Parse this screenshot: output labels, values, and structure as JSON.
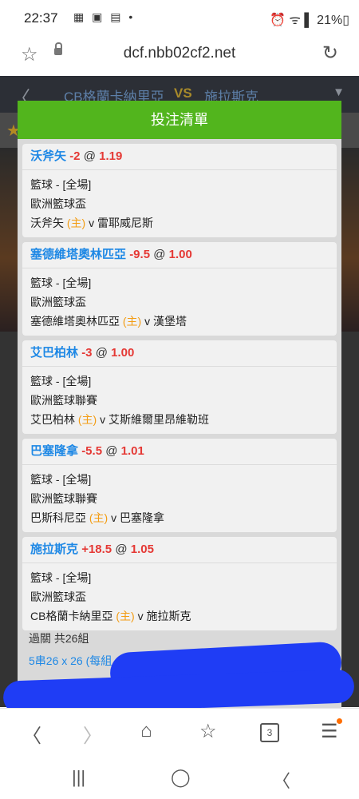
{
  "status_bar": {
    "time": "22:37",
    "icons": "▦ ▣ ▤ •",
    "right": "⏰ ᯤ ▌ 21%▯"
  },
  "browser": {
    "url": "dcf.nbb02cf2.net"
  },
  "page": {
    "team1": "CB格蘭卡納里亞",
    "vs": "VS",
    "team2": "施拉斯克"
  },
  "modal": {
    "title": "投注清單",
    "bets": [
      {
        "team": "沃斧矢",
        "line": "-2",
        "at": "@",
        "odds": "1.19",
        "sport": "籃球 - [全場]",
        "league": "歐洲籃球盃",
        "home_team": "沃斧矢",
        "home_tag": "(主)",
        "versus": "v 雷耶威尼斯"
      },
      {
        "team": "塞德維塔奧林匹亞",
        "line": "-9.5",
        "at": "@",
        "odds": "1.00",
        "sport": "籃球 - [全場]",
        "league": "歐洲籃球盃",
        "home_team": "塞德維塔奧林匹亞",
        "home_tag": "(主)",
        "versus": "v 漢堡塔"
      },
      {
        "team": "艾巴柏林",
        "line": "-3",
        "at": "@",
        "odds": "1.00",
        "sport": "籃球 - [全場]",
        "league": "歐洲籃球聯賽",
        "home_team": "艾巴柏林",
        "home_tag": "(主)",
        "versus": "v 艾斯維爾里昂維勒班"
      },
      {
        "team": "巴塞隆拿",
        "line": "-5.5",
        "at": "@",
        "odds": "1.01",
        "sport": "籃球 - [全場]",
        "league": "歐洲籃球聯賽",
        "home_team": "巴斯科尼亞",
        "home_tag": "(主)",
        "versus": "v 巴塞隆拿"
      },
      {
        "team": "施拉斯克",
        "line": "+18.5",
        "at": "@",
        "odds": "1.05",
        "sport": "籃球 - [全場]",
        "league": "歐洲籃球盃",
        "home_team": "CB格蘭卡納里亞",
        "home_tag": "(主)",
        "versus": "v 施拉斯克"
      }
    ],
    "summary_line1": "過關 共26組",
    "summary_line2": "5串26 x 26 (每組"
  },
  "bottom_nav": {
    "back": "〈",
    "forward": "〉",
    "home": "⌂",
    "star": "☆",
    "tabs_count": "3",
    "menu": "☰"
  },
  "system_nav": {
    "recents": "|||",
    "home": "◯",
    "back": "〈"
  }
}
